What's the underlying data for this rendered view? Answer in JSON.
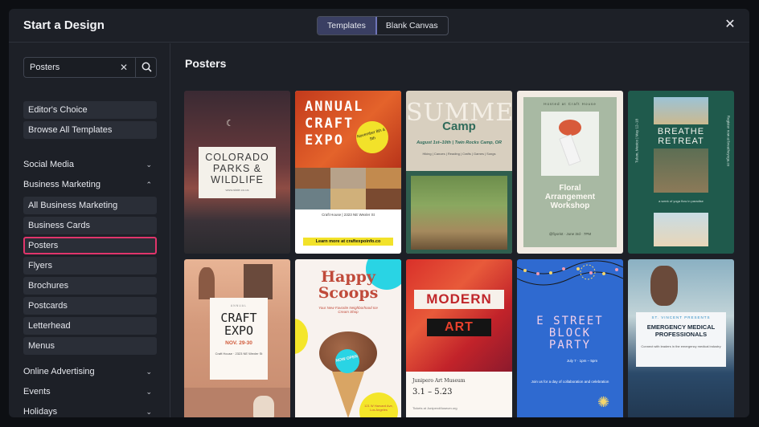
{
  "header": {
    "title": "Start a Design",
    "tabs": [
      {
        "label": "Templates",
        "active": true
      },
      {
        "label": "Blank Canvas",
        "active": false
      }
    ],
    "close_icon": "close-icon"
  },
  "sidebar": {
    "search": {
      "value": "Posters",
      "clear_icon": "clear-icon",
      "search_icon": "search-icon"
    },
    "top_buttons": [
      "Editor's Choice",
      "Browse All Templates"
    ],
    "categories": [
      {
        "label": "Social Media",
        "expanded": false
      },
      {
        "label": "Business Marketing",
        "expanded": true
      },
      {
        "label": "Online Advertising",
        "expanded": false
      },
      {
        "label": "Events",
        "expanded": false
      },
      {
        "label": "Holidays",
        "expanded": false
      }
    ],
    "business_items": [
      "All Business Marketing",
      "Business Cards",
      "Posters",
      "Flyers",
      "Brochures",
      "Postcards",
      "Letterhead",
      "Menus"
    ],
    "selected": "Posters"
  },
  "content": {
    "title": "Posters",
    "templates": [
      {
        "name": "Colorado Parks & Wildlife",
        "lines": [
          "COLORADO",
          "PARKS &",
          "WILDLIFE"
        ],
        "footer": "www.state.co.us"
      },
      {
        "name": "Annual Craft Expo",
        "lines": [
          "ANNUAL",
          "CRAFT",
          "EXPO"
        ],
        "badge": "November 8th & 9th",
        "address": "Craft House | 2323 NE Wexler St",
        "cta": "Learn more at craftexpoinfo.co"
      },
      {
        "name": "Summer Camp",
        "lines": [
          "SUMMER",
          "Camp"
        ],
        "sub": "August 1st–10th | Twin Rocks Camp, OR",
        "info": "Hiking | Canoes | Reading | Crafts | Games | Songs"
      },
      {
        "name": "Floral Arrangement Workshop",
        "top": "Hosted at Craft House",
        "lines": [
          "Floral",
          "Arrangement",
          "Workshop"
        ],
        "info": "@fiyorist · June 3rd · 7PM"
      },
      {
        "name": "Breathe Retreat",
        "lines": [
          "BREATHE",
          "RETREAT"
        ],
        "sub": "a week of yoga flow in paradise",
        "side": "Register now at breatheyoga.co",
        "side2": "Tulum, Mexico | May 12–18"
      },
      {
        "name": "Craft Expo",
        "top": "ANNUAL",
        "lines": [
          "CRAFT",
          "EXPO"
        ],
        "date": "NOV. 29-30",
        "info": "Craft House · 2323 NE Wexler St"
      },
      {
        "name": "Happy Scoops",
        "lines": [
          "Happy",
          "Scoops"
        ],
        "sub": "Your New Favorite Neighborhood Ice Cream Shop",
        "badge": "NOW OPEN",
        "address": "121 W Harvard Ave, Los Angeles"
      },
      {
        "name": "Modern Art",
        "lines": [
          "MODERN",
          "ART"
        ],
        "venue": "Junipero Art Museum",
        "date": "3.1 – 5.23",
        "info": "Tickets at JuniperoMuseum.org"
      },
      {
        "name": "E Street Block Party",
        "lines": [
          "E STREET",
          "BLOCK",
          "PARTY"
        ],
        "date": "July 7 · 1pm – 5pm",
        "info": "Join us for a day of collaboration and celebration"
      },
      {
        "name": "Emergency Medical Professionals",
        "top": "ST. VINCENT PRESENTS",
        "lines": [
          "EMERGENCY MEDICAL",
          "PROFESSIONALS"
        ],
        "info": "Connect with leaders in the emergency medical industry"
      }
    ]
  },
  "colors": {
    "accent": "#e0356b",
    "active_tab": "#3a3f63",
    "panel": "#1d2027"
  }
}
